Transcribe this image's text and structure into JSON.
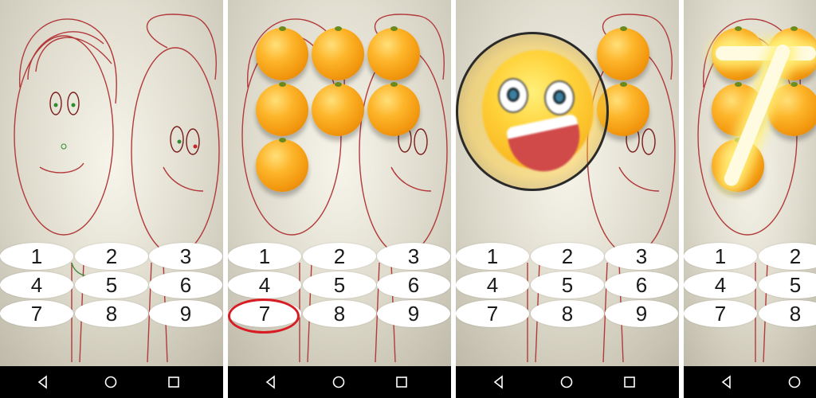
{
  "screens": [
    {
      "name": "panel-1",
      "state": "empty"
    },
    {
      "name": "panel-2",
      "state": "seven-fruits",
      "highlighted_key": "7"
    },
    {
      "name": "panel-3",
      "state": "magnifier-emoji"
    },
    {
      "name": "panel-4",
      "state": "glowing-seven"
    }
  ],
  "keypad": {
    "keys": [
      "1",
      "2",
      "3",
      "4",
      "5",
      "6",
      "7",
      "8",
      "9"
    ]
  },
  "navigation": {
    "back_icon": "back-triangle-icon",
    "home_icon": "home-circle-icon",
    "recent_icon": "recent-square-icon"
  },
  "colors": {
    "highlight_ring": "#d81c24",
    "navbar": "#000000",
    "fruit": "#f39a10"
  }
}
